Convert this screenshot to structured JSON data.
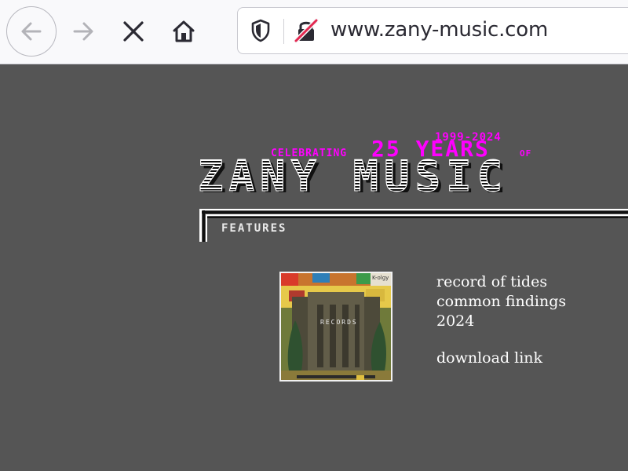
{
  "browser": {
    "url": "www.zany-music.com",
    "icons": [
      "back-arrow-icon",
      "forward-arrow-icon",
      "close-icon",
      "home-icon",
      "shield-icon",
      "insecure-lock-icon"
    ],
    "colors": {
      "toolbar": "#f9f9fb",
      "icon": "#2b2a33",
      "insecure_slash": "#e22850"
    }
  },
  "site": {
    "banner": {
      "years": "1999-2024",
      "celebrating": "CELEBRATING",
      "highlight": "25 YEARS",
      "of": "OF",
      "title": "ZANY MUSIC"
    },
    "section_label": "FEATURES",
    "feature": {
      "album_art_text": "RECORDS",
      "album_badge": "K-olgy",
      "title": "record of tides",
      "artist": "common findings",
      "year": "2024",
      "link_text": "download link"
    },
    "colors": {
      "background": "#555555",
      "magenta": "#ff00ff",
      "text": "#ffffff"
    }
  }
}
